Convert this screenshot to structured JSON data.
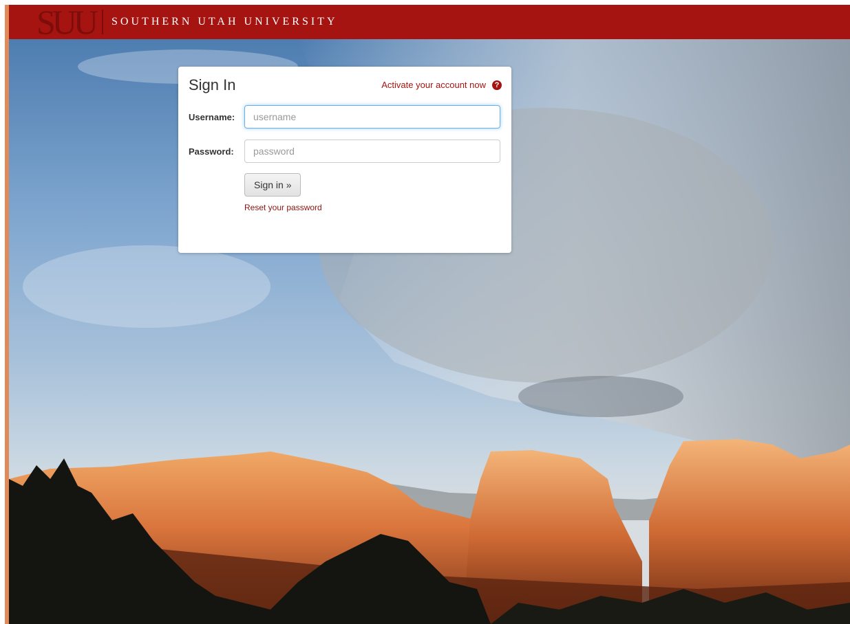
{
  "header": {
    "logo_mark": "SUU",
    "university_name": "SOUTHERN UTAH UNIVERSITY"
  },
  "signin": {
    "title": "Sign In",
    "activate_link": "Activate your account now",
    "help_icon": "question-circle-icon",
    "username_label": "Username:",
    "username_placeholder": "username",
    "password_label": "Password:",
    "password_placeholder": "password",
    "submit_label": "Sign in »",
    "reset_link": "Reset your password"
  },
  "colors": {
    "brand_red": "#a51410",
    "link_red": "#a51410",
    "focus_blue": "#66afe9"
  }
}
